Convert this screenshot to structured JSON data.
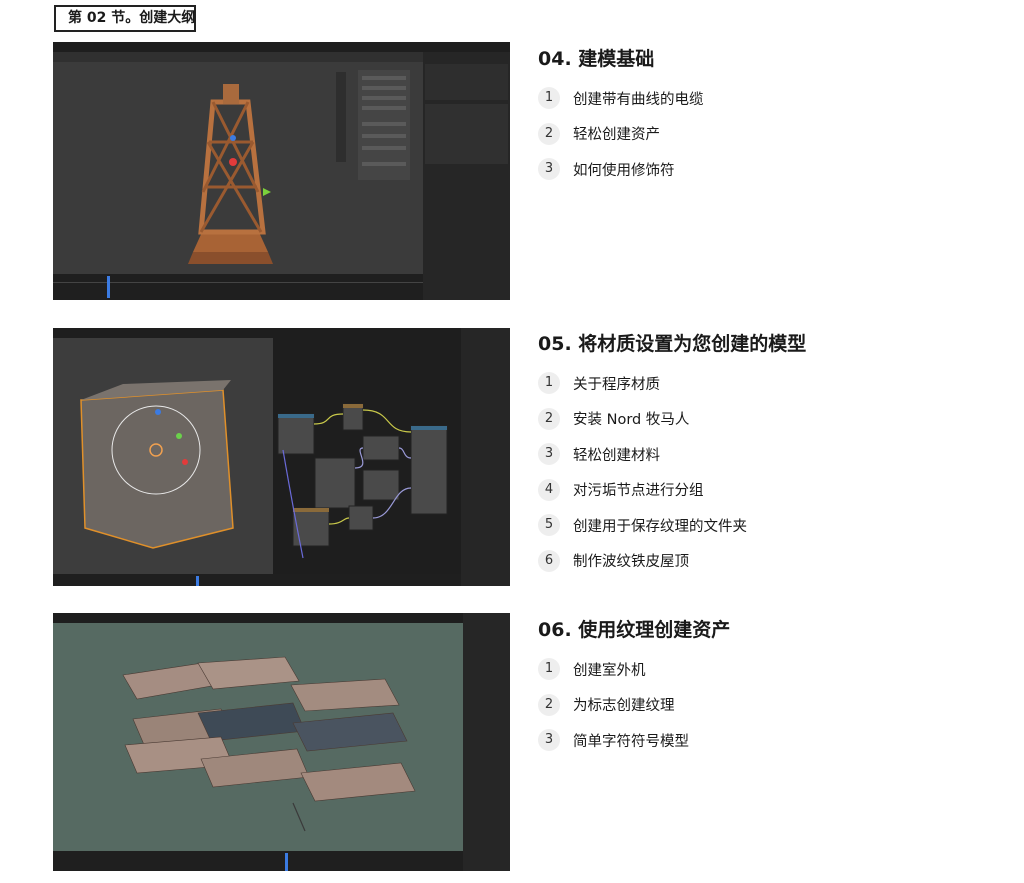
{
  "section_title": "第 02 节。创建大纲",
  "chapters": [
    {
      "title": "04. 建模基础",
      "items": [
        "创建带有曲线的电缆",
        "轻松创建资产",
        "如何使用修饰符"
      ]
    },
    {
      "title": "05. 将材质设置为您创建的模型",
      "items": [
        "关于程序材质",
        "安装 Nord 牧马人",
        "轻松创建材料",
        "对污垢节点进行分组",
        "创建用于保存纹理的文件夹",
        "制作波纹铁皮屋顶"
      ]
    },
    {
      "title": "06. 使用纹理创建资产",
      "items": [
        "创建室外机",
        "为标志创建纹理",
        "简单字符符号模型"
      ]
    }
  ],
  "colors": {
    "viewport_dark": "#3a3a3a",
    "viewport_teal": "#566a62",
    "panel": "#2b2b2b",
    "tower": "#a0603a",
    "badge_bg": "#eeeeee"
  }
}
